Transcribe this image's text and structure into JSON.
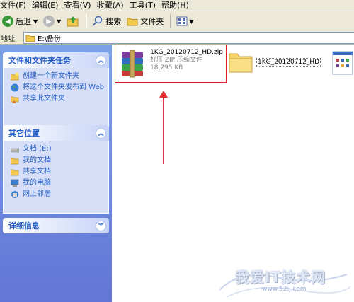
{
  "menu": [
    "文件(F)",
    "编辑(E)",
    "查看(V)",
    "收藏(A)",
    "工具(T)",
    "帮助(H)"
  ],
  "toolbar": {
    "back_label": "后退",
    "search_label": "搜索",
    "folders_label": "文件夹"
  },
  "address": {
    "label": "地址",
    "path": "E:\\备份"
  },
  "tasks_panel": {
    "title": "文件和文件夹任务",
    "items": [
      "创建一个新文件夹",
      "将这个文件夹发布到 Web",
      "共享此文件夹"
    ]
  },
  "places_panel": {
    "title": "其它位置",
    "items": [
      "文档 (E:)",
      "我的文档",
      "共享文档",
      "我的电脑",
      "网上邻居"
    ]
  },
  "details_panel": {
    "title": "详细信息"
  },
  "files": [
    {
      "name": "1KG_20120712_HD.zip",
      "type": "好压 ZIP 压缩文件",
      "size": "18,295 KB"
    },
    {
      "name": "1KG_20120712_HD"
    }
  ],
  "watermark": {
    "text": "我爱IT技术网",
    "url": "www.52ij.com"
  },
  "colors": {
    "pane_top": "#7ba2e7",
    "pane_bottom": "#6375d6",
    "link": "#215dc6",
    "annotation": "#e02020"
  }
}
